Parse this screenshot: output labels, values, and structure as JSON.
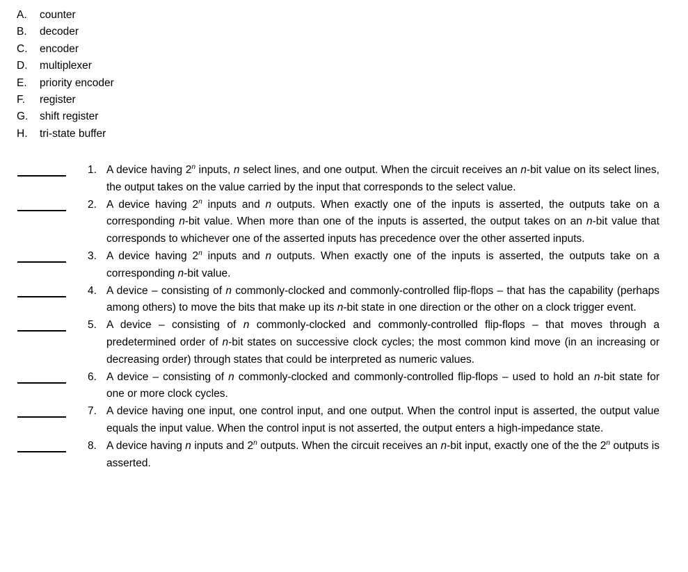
{
  "answer_key": {
    "items": [
      {
        "letter": "A.",
        "label": "counter"
      },
      {
        "letter": "B.",
        "label": "decoder"
      },
      {
        "letter": "C.",
        "label": "encoder"
      },
      {
        "letter": "D.",
        "label": "multiplexer"
      },
      {
        "letter": "E.",
        "label": "priority encoder"
      },
      {
        "letter": "F.",
        "label": "register"
      },
      {
        "letter": "G.",
        "label": "shift register"
      },
      {
        "letter": "H.",
        "label": "tri-state buffer"
      }
    ]
  },
  "questions": {
    "items": [
      {
        "number": "1.",
        "blank_value": "",
        "text": "A device having 2ⁿ inputs, n select lines, and one output. When the circuit receives an n-bit value on its select lines, the output takes on the value carried by the input that corresponds to the select value.",
        "html": "A device having 2<sup>n</sup> inputs, <i>n</i> select lines, and one output. When the circuit receives an <i>n</i>-bit value on its select lines, the output takes on the value carried by the input that corresponds to the select value."
      },
      {
        "number": "2.",
        "blank_value": "",
        "text": "A device having 2ⁿ inputs and n outputs. When exactly one of the inputs is asserted, the outputs take on a corresponding n-bit value. When more than one of the inputs is asserted, the output takes on an n-bit value that corresponds to whichever one of the asserted inputs has precedence over the other asserted inputs.",
        "html": "A device having 2<sup>n</sup> inputs and <i>n</i> outputs. When exactly one of the inputs is asserted, the outputs take on a corresponding <i>n</i>-bit value. When more than one of the inputs is asserted, the output takes on an <i>n</i>-bit value that corresponds to whichever one of the asserted inputs has precedence over the other asserted inputs."
      },
      {
        "number": "3.",
        "blank_value": "",
        "text": "A device having 2ⁿ inputs and n outputs. When exactly one of the inputs is asserted, the outputs take on a corresponding n-bit value.",
        "html": "A device having 2<sup>n</sup> inputs and <i>n</i> outputs. When exactly one of the inputs is asserted, the outputs take on a corresponding <i>n</i>-bit value."
      },
      {
        "number": "4.",
        "blank_value": "",
        "text": "A device – consisting of n commonly-clocked and commonly-controlled flip-flops – that has the capability (perhaps among others) to move the bits that make up its n-bit state in one direction or the other on a clock trigger event.",
        "html": "A device – consisting of <i>n</i> commonly-clocked and commonly-controlled flip-flops – that has the capability (perhaps among others) to move the bits that make up its <i>n</i>-bit state in one direction or the other on a clock trigger event."
      },
      {
        "number": "5.",
        "blank_value": "",
        "text": "A device – consisting of n commonly-clocked and commonly-controlled flip-flops – that moves through a predetermined order of n-bit states on successive clock cycles; the most common kind move (in an increasing or decreasing order) through states that could be interpreted as numeric values.",
        "html": "A device – consisting of <i>n</i> commonly-clocked and commonly-controlled flip-flops – that moves through a predetermined order of <i>n</i>-bit states on successive clock cycles; the most common kind move (in an increasing or decreasing order) through states that could be interpreted as numeric values."
      },
      {
        "number": "6.",
        "blank_value": "",
        "text": "A device – consisting of n commonly-clocked and commonly-controlled flip-flops – used to hold an n-bit state for one or more clock cycles.",
        "html": "A device – consisting of <i>n</i> commonly-clocked and commonly-controlled flip-flops – used to hold an <i>n</i>-bit state for one or more clock cycles."
      },
      {
        "number": "7.",
        "blank_value": "",
        "text": "A device having one input, one control input, and one output. When the control input is asserted, the output value equals the input value. When the control input is not asserted, the output enters a high-impedance state.",
        "html": "A device having one input, one control input, and one output. When the control input is asserted, the output value equals the input value. When the control input is not asserted, the output enters a high-impedance state."
      },
      {
        "number": "8.",
        "blank_value": "",
        "text": "A device having n inputs and 2ⁿ outputs. When the circuit receives an n-bit input, exactly one of the the 2ⁿ outputs is asserted.",
        "html": "A device having <i>n</i> inputs and 2<sup>n</sup> outputs. When the circuit receives an <i>n</i>-bit input, exactly one of the the 2<sup>n</sup> outputs is asserted."
      }
    ]
  }
}
